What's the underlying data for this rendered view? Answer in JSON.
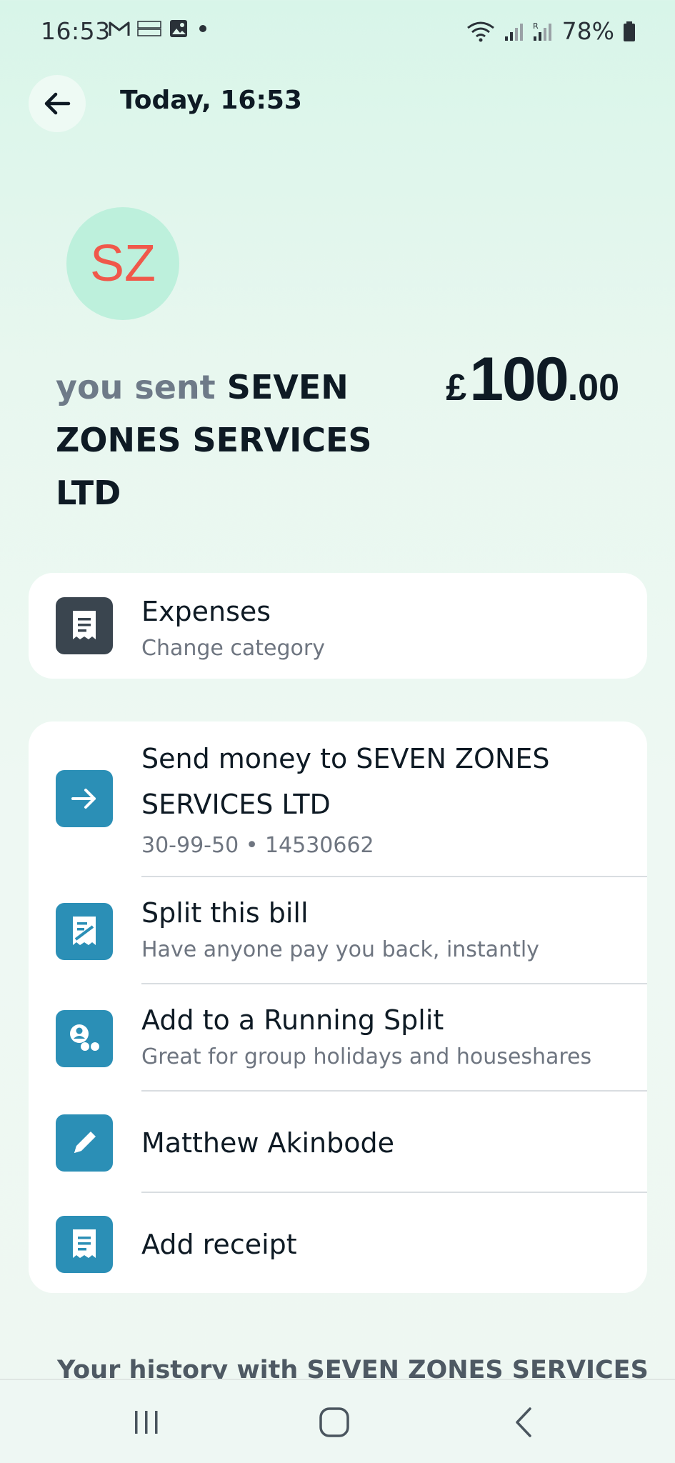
{
  "status_bar": {
    "time": "16:53",
    "battery": "78%",
    "icons": [
      "gmail-icon",
      "temu-icon",
      "gallery-icon",
      "dot-icon",
      "wifi-icon",
      "signal-icon",
      "signal-roaming-icon",
      "battery-icon"
    ]
  },
  "header": {
    "title": "Today, 16:53",
    "back_icon": "arrow-left-icon"
  },
  "recipient": {
    "initials": "SZ",
    "sent_prefix": "you sent ",
    "name": "SEVEN ZONES SERVICES LTD"
  },
  "amount": {
    "currency": "£",
    "major": "100",
    "minor": ".00"
  },
  "category": {
    "title": "Expenses",
    "subtitle": "Change category",
    "icon": "receipt-icon"
  },
  "actions": [
    {
      "title": "Send money to SEVEN ZONES SERVICES LTD",
      "subtitle": "30-99-50 • 14530662",
      "icon": "arrow-right-icon"
    },
    {
      "title": "Split this bill",
      "subtitle": "Have anyone pay you back, instantly",
      "icon": "split-bill-icon"
    },
    {
      "title": "Add to a Running Split",
      "subtitle": "Great for group holidays and houseshares",
      "icon": "group-icon"
    },
    {
      "title": "Matthew Akinbode",
      "subtitle": "",
      "icon": "pencil-icon"
    },
    {
      "title": "Add receipt",
      "subtitle": "",
      "icon": "receipt-icon"
    }
  ],
  "history_heading": "Your history with SEVEN ZONES SERVICES",
  "colors": {
    "accent_blue": "#2b8fb6",
    "avatar_bg": "#bdf0dc",
    "avatar_text": "#f0584a",
    "text_dark": "#0e1a24"
  }
}
